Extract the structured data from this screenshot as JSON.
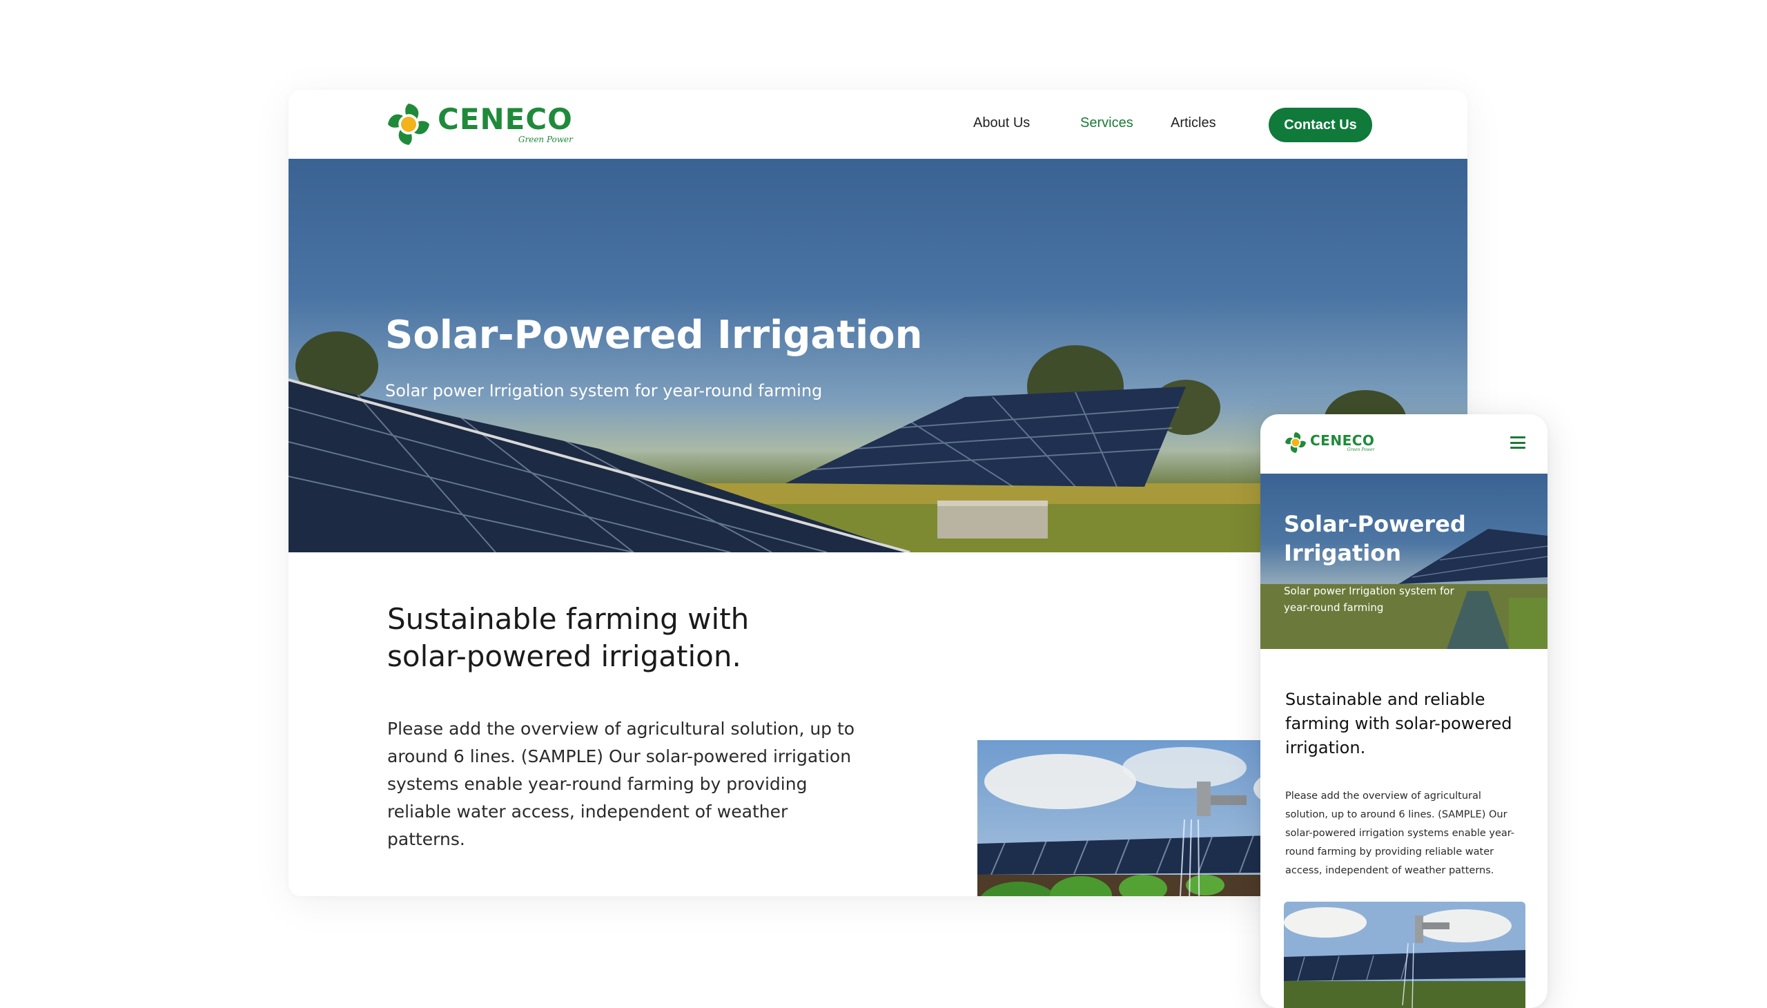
{
  "brand": {
    "name": "CENECO",
    "tagline": "Green Power",
    "primary_color": "#0f7a3a",
    "logo_icon": "pinwheel-sun-logo"
  },
  "nav": {
    "items": [
      {
        "label": "About Us",
        "active": false
      },
      {
        "label": "Services",
        "active": true
      },
      {
        "label": "Articles",
        "active": false
      }
    ],
    "cta": "Contact Us"
  },
  "hero": {
    "title": "Solar-Powered Irrigation",
    "subtitle": "Solar power Irrigation system for year-round farming"
  },
  "section": {
    "heading": "Sustainable farming with solar-powered irrigation.",
    "paragraph": "Please add the overview of agricultural solution, up to around 6 lines. (SAMPLE) Our solar-powered irrigation systems enable year-round farming by providing reliable water access, independent of weather patterns."
  },
  "mobile": {
    "menu_icon": "hamburger-menu-icon",
    "hero_title": "Solar-Powered Irrigation",
    "hero_subtitle": "Solar power Irrigation system for year-round farming",
    "heading": "Sustainable and reliable farming with solar-powered irrigation.",
    "paragraph": "Please add the overview of agricultural solution, up to around 6 lines. (SAMPLE) Our solar-powered irrigation systems enable year-round farming by providing reliable water access, independent of weather patterns."
  }
}
